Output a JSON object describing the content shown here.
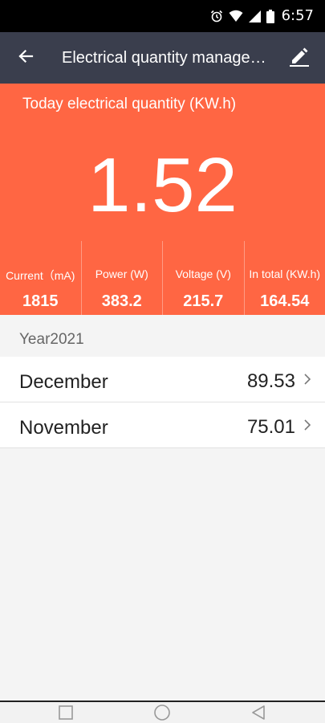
{
  "status_bar": {
    "time": "6:57",
    "icons": [
      "alarm-icon",
      "wifi-icon",
      "cell-signal-icon",
      "battery-icon"
    ]
  },
  "app_bar": {
    "title": "Electrical quantity management",
    "back_icon": "arrow-back-icon",
    "edit_icon": "pencil-icon"
  },
  "summary": {
    "today_label": "Today electrical quantity (KW.h)",
    "today_value": "1.52",
    "background_color": "#ff6643",
    "metrics": [
      {
        "label": "Current（mA)",
        "value": "1815"
      },
      {
        "label": "Power (W)",
        "value": "383.2"
      },
      {
        "label": "Voltage (V)",
        "value": "215.7"
      },
      {
        "label": "In total (KW.h)",
        "value": "164.54"
      }
    ]
  },
  "year_section": {
    "label": "Year2021"
  },
  "months": [
    {
      "name": "December",
      "value": "89.53"
    },
    {
      "name": "November",
      "value": "75.01"
    }
  ],
  "nav_bar": {
    "icons": [
      "recents-square-icon",
      "home-circle-icon",
      "back-triangle-icon"
    ]
  }
}
